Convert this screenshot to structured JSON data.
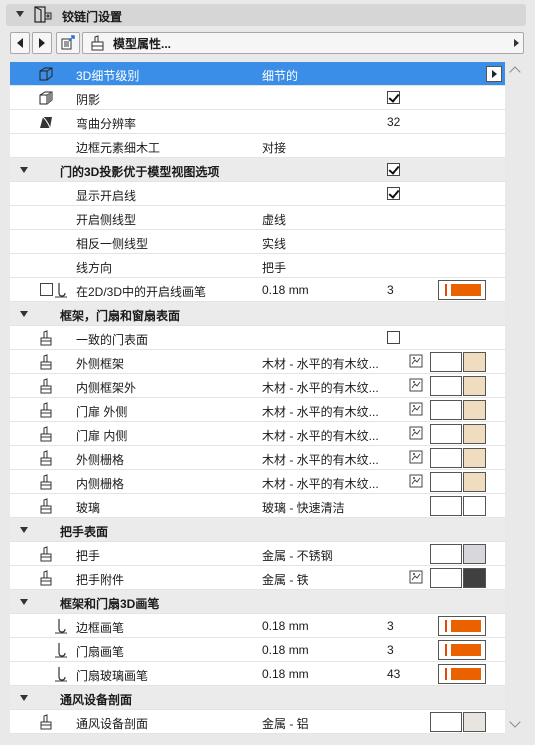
{
  "header": {
    "title": "铰链门设置",
    "icon": "door-settings-icon"
  },
  "toolbar": {
    "model_label": "模型属性..."
  },
  "colors": {
    "selection": "#3a8ee8",
    "pen_orange": "#ea6100",
    "wood_swatch": "#f0dcbe",
    "metal_swatch": "#d8d8dc",
    "iron_swatch": "#404040",
    "alum_swatch": "#e8e4e0"
  },
  "rows": [
    {
      "kind": "item",
      "icon": "cube-icon",
      "name": "3D细节级别",
      "value": "细节的",
      "selected": true
    },
    {
      "kind": "item",
      "icon": "shadow-cube-icon",
      "name": "阴影",
      "checkbox": true
    },
    {
      "kind": "item",
      "icon": "curve-resolution-icon",
      "name": "弯曲分辨率",
      "num": "32"
    },
    {
      "kind": "item",
      "name": "边框元素细木工",
      "value": "对接"
    },
    {
      "kind": "section",
      "name": "门的3D投影优于模型视图选项",
      "checkbox": true
    },
    {
      "kind": "item",
      "name": "显示开启线",
      "checkbox": true
    },
    {
      "kind": "item",
      "name": "开启侧线型",
      "value": "虚线"
    },
    {
      "kind": "item",
      "name": "相反一侧线型",
      "value": "实线"
    },
    {
      "kind": "item",
      "name": "线方向",
      "value": "把手"
    },
    {
      "kind": "item",
      "leftcheck": true,
      "icon2": "pen-icon",
      "name": "在2D/3D中的开启线画笔",
      "value": "0.18 mm",
      "num": "3",
      "pen": true
    },
    {
      "kind": "section",
      "name": "框架，门扇和窗扇表面"
    },
    {
      "kind": "item",
      "icon": "surface-brush-icon",
      "name": "一致的门表面",
      "checkbox": false
    },
    {
      "kind": "item",
      "icon": "surface-brush-icon",
      "name": "外侧框架",
      "value": "木材 - 水平的有木纹...",
      "picker": true,
      "swatch": "wood"
    },
    {
      "kind": "item",
      "icon": "surface-brush-icon",
      "name": "内侧框架外",
      "value": "木材 - 水平的有木纹...",
      "picker": true,
      "swatch": "wood"
    },
    {
      "kind": "item",
      "icon": "surface-brush-icon",
      "name": "门扉 外侧",
      "value": "木材 - 水平的有木纹...",
      "picker": true,
      "swatch": "wood"
    },
    {
      "kind": "item",
      "icon": "surface-brush-icon",
      "name": "门扉 内侧",
      "value": "木材 - 水平的有木纹...",
      "picker": true,
      "swatch": "wood"
    },
    {
      "kind": "item",
      "icon": "surface-brush-icon",
      "name": "外侧栅格",
      "value": "木材 - 水平的有木纹...",
      "picker": true,
      "swatch": "wood"
    },
    {
      "kind": "item",
      "icon": "surface-brush-icon",
      "name": "内侧栅格",
      "value": "木材 - 水平的有木纹...",
      "picker": true,
      "swatch": "wood"
    },
    {
      "kind": "item",
      "icon": "surface-brush-icon",
      "name": "玻璃",
      "value": "玻璃 - 快速清洁",
      "swatch": "glass"
    },
    {
      "kind": "section",
      "name": "把手表面"
    },
    {
      "kind": "item",
      "icon": "surface-brush-icon",
      "name": "把手",
      "value": "金属 - 不锈钢",
      "swatch": "metal"
    },
    {
      "kind": "item",
      "icon": "surface-brush-icon",
      "name": "把手附件",
      "value": "金属 - 铁",
      "picker": true,
      "swatch": "iron"
    },
    {
      "kind": "section",
      "name": "框架和门扇3D画笔"
    },
    {
      "kind": "item",
      "icon2": "pen-icon",
      "name": "边框画笔",
      "value": "0.18 mm",
      "num": "3",
      "pen": true
    },
    {
      "kind": "item",
      "icon2": "pen-icon",
      "name": "门扇画笔",
      "value": "0.18 mm",
      "num": "3",
      "pen": true
    },
    {
      "kind": "item",
      "icon2": "pen-icon",
      "name": "门扇玻璃画笔",
      "value": "0.18 mm",
      "num": "43",
      "pen": true
    },
    {
      "kind": "section",
      "name": "通风设备剖面"
    },
    {
      "kind": "item",
      "icon": "surface-brush-icon",
      "name": "通风设备剖面",
      "value": "金属 - 铝",
      "swatch": "alum"
    }
  ]
}
